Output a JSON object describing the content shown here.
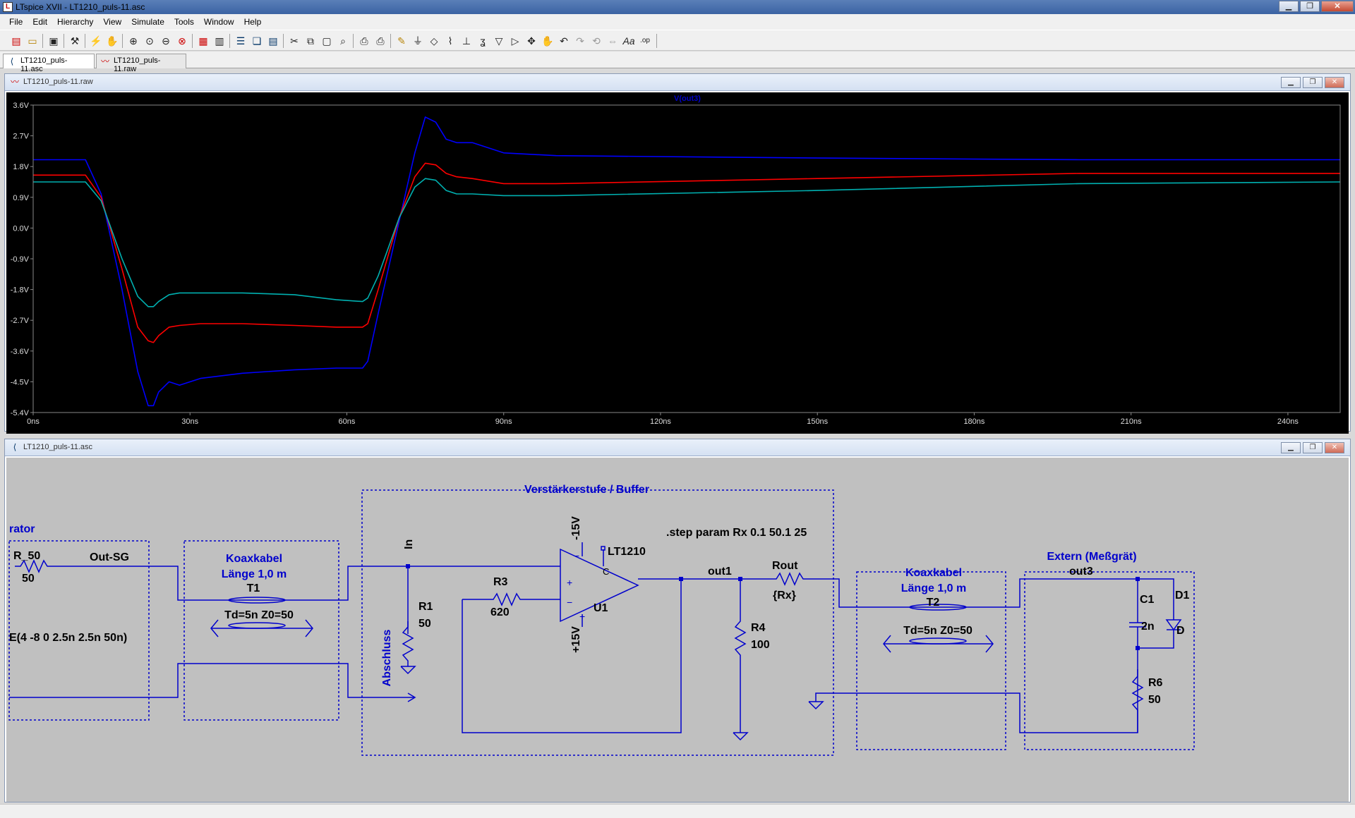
{
  "window": {
    "title": "LTspice XVII - LT1210_puls-11.asc",
    "icon": "ltspice-logo-icon"
  },
  "menu": [
    "File",
    "Edit",
    "Hierarchy",
    "View",
    "Simulate",
    "Tools",
    "Window",
    "Help"
  ],
  "tabs": [
    {
      "label": "LT1210_puls-11.asc",
      "icon": "schematic-icon",
      "active": true
    },
    {
      "label": "LT1210_puls-11.raw",
      "icon": "waveform-icon",
      "active": false
    }
  ],
  "plot_window": {
    "title": "LT1210_puls-11.raw",
    "trace_label": "V(out3)",
    "trace_label_color": "#0000cc"
  },
  "schematic_window": {
    "title": "LT1210_puls-11.asc"
  },
  "chart_data": {
    "type": "line",
    "title": "V(out3)",
    "xlabel": "",
    "ylabel": "",
    "x_unit": "ns",
    "y_unit": "V",
    "xlim": [
      0,
      250
    ],
    "ylim": [
      -5.4,
      3.6
    ],
    "x_ticks": [
      "0ns",
      "30ns",
      "60ns",
      "90ns",
      "120ns",
      "150ns",
      "180ns",
      "210ns",
      "240ns"
    ],
    "y_ticks": [
      "3.6V",
      "2.7V",
      "1.8V",
      "0.9V",
      "0.0V",
      "-0.9V",
      "-1.8V",
      "-2.7V",
      "-3.6V",
      "-4.5V",
      "-5.4V"
    ],
    "grid": false,
    "background": "#000000",
    "series": [
      {
        "color": "#0000ff",
        "x": [
          0,
          6,
          10,
          13,
          17,
          20,
          22,
          23,
          24,
          26,
          28,
          32,
          40,
          50,
          58,
          63,
          64,
          66,
          70,
          73,
          75,
          77,
          79,
          81,
          84,
          90,
          100,
          150,
          200,
          250
        ],
        "y": [
          2.0,
          2.0,
          2.0,
          1.0,
          -1.8,
          -4.2,
          -5.2,
          -5.2,
          -4.8,
          -4.5,
          -4.6,
          -4.4,
          -4.25,
          -4.15,
          -4.1,
          -4.1,
          -3.9,
          -2.5,
          0.2,
          2.2,
          3.25,
          3.1,
          2.6,
          2.5,
          2.5,
          2.2,
          2.12,
          2.05,
          2.0,
          2.0
        ]
      },
      {
        "color": "#ff0000",
        "x": [
          0,
          6,
          10,
          13,
          17,
          20,
          22,
          23,
          24,
          26,
          28,
          32,
          40,
          50,
          58,
          63,
          64,
          66,
          70,
          73,
          75,
          77,
          79,
          81,
          84,
          90,
          100,
          150,
          200,
          250
        ],
        "y": [
          1.55,
          1.55,
          1.55,
          0.9,
          -1.2,
          -2.9,
          -3.3,
          -3.35,
          -3.15,
          -2.9,
          -2.85,
          -2.8,
          -2.8,
          -2.85,
          -2.9,
          -2.9,
          -2.8,
          -1.8,
          0.3,
          1.5,
          1.9,
          1.85,
          1.6,
          1.5,
          1.45,
          1.3,
          1.3,
          1.45,
          1.6,
          1.6
        ]
      },
      {
        "color": "#00b0b0",
        "x": [
          0,
          6,
          10,
          13,
          17,
          20,
          22,
          23,
          24,
          26,
          28,
          32,
          40,
          50,
          58,
          63,
          64,
          66,
          70,
          73,
          75,
          77,
          79,
          81,
          84,
          90,
          100,
          150,
          200,
          250
        ],
        "y": [
          1.35,
          1.35,
          1.35,
          0.8,
          -0.9,
          -2.0,
          -2.3,
          -2.3,
          -2.15,
          -1.95,
          -1.9,
          -1.9,
          -1.9,
          -1.95,
          -2.1,
          -2.15,
          -2.05,
          -1.4,
          0.3,
          1.2,
          1.45,
          1.4,
          1.1,
          1.0,
          1.0,
          0.95,
          0.95,
          1.1,
          1.3,
          1.35
        ]
      }
    ]
  },
  "schematic": {
    "blocks": {
      "generator_label": "rator",
      "buffer_title": "Verstärkerstufe / Buffer",
      "coax1_title": [
        "Koaxkabel",
        "Länge 1,0 m"
      ],
      "coax2_title": [
        "Koaxkabel",
        "Länge 1,0 m"
      ],
      "extern_title": "Extern (Meßgrät)"
    },
    "labels": {
      "r50_name": "R_50",
      "r50_value": "50",
      "out_sg": "Out-SG",
      "pulse": "E(4 -8 0 2.5n 2.5n 50n)",
      "t1": "T1",
      "t1_params": "Td=5n Z0=50",
      "in": "In",
      "abschluss": "Abschluss",
      "r1": "R1",
      "r1_value": "50",
      "r3": "R3",
      "r3_value": "620",
      "neg15": "-15V",
      "pos15": "+15V",
      "opamp": "LT1210",
      "u1": "U1",
      "c_pin": "C",
      "out1": "out1",
      "rout": "Rout",
      "rout_value": "{Rx}",
      "r4": "R4",
      "r4_value": "100",
      "step": ".step param Rx 0.1 50.1 25",
      "t2": "T2",
      "t2_params": "Td=5n Z0=50",
      "out3": "out3",
      "c1": "C1",
      "c1_value": "2n",
      "d1": "D1",
      "d1_value": "D",
      "r6": "R6",
      "r6_value": "50"
    }
  }
}
